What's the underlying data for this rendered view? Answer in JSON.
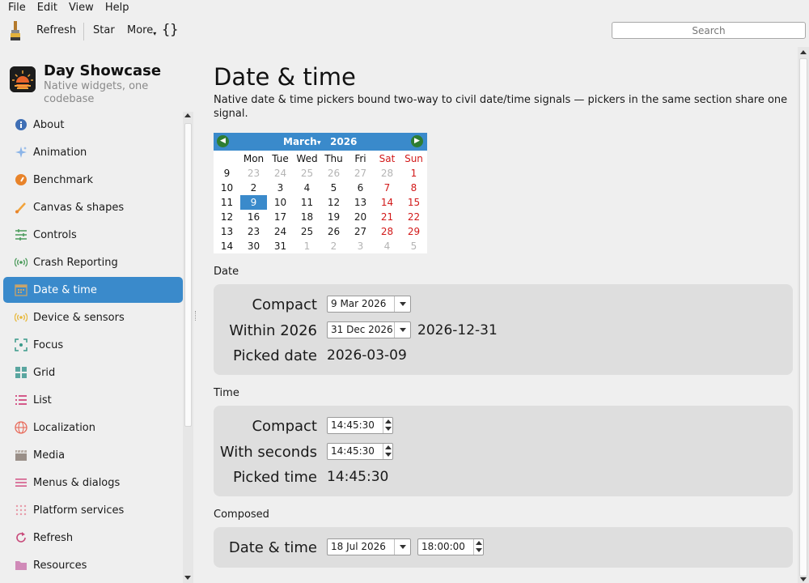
{
  "menu": [
    "File",
    "Edit",
    "View",
    "Help"
  ],
  "toolbar": {
    "refresh": "Refresh",
    "star": "Star",
    "more": "More",
    "braces": "{}",
    "search_placeholder": "Search"
  },
  "app": {
    "title": "Day Showcase",
    "subtitle": "Native widgets, one codebase"
  },
  "sidebar": {
    "items": [
      {
        "label": "About",
        "icon": "info-icon",
        "active": false
      },
      {
        "label": "Animation",
        "icon": "sparkle-icon",
        "active": false
      },
      {
        "label": "Benchmark",
        "icon": "gauge-icon",
        "active": false
      },
      {
        "label": "Canvas & shapes",
        "icon": "brush-icon",
        "active": false
      },
      {
        "label": "Controls",
        "icon": "sliders-icon",
        "active": false
      },
      {
        "label": "Crash Reporting",
        "icon": "broadcast-icon",
        "active": false
      },
      {
        "label": "Date & time",
        "icon": "calendar-icon",
        "active": true
      },
      {
        "label": "Device & sensors",
        "icon": "sensor-icon",
        "active": false
      },
      {
        "label": "Focus",
        "icon": "focus-icon",
        "active": false
      },
      {
        "label": "Grid",
        "icon": "grid-icon",
        "active": false
      },
      {
        "label": "List",
        "icon": "list-icon",
        "active": false
      },
      {
        "label": "Localization",
        "icon": "globe-icon",
        "active": false
      },
      {
        "label": "Media",
        "icon": "clapper-icon",
        "active": false
      },
      {
        "label": "Menus & dialogs",
        "icon": "menu-icon",
        "active": false
      },
      {
        "label": "Platform services",
        "icon": "dots-grid-icon",
        "active": false
      },
      {
        "label": "Refresh",
        "icon": "refresh-icon",
        "active": false
      },
      {
        "label": "Resources",
        "icon": "folder-icon",
        "active": false
      }
    ]
  },
  "page": {
    "title": "Date & time",
    "description": "Native date & time pickers bound two-way to civil date/time signals — pickers in the same section share one signal."
  },
  "calendar": {
    "month": "March",
    "year": "2026",
    "weekdays": [
      "Mon",
      "Tue",
      "Wed",
      "Thu",
      "Fri",
      "Sat",
      "Sun"
    ],
    "weeks": [
      {
        "wk": "9",
        "days": [
          "23",
          "24",
          "25",
          "26",
          "27",
          "28",
          "1"
        ]
      },
      {
        "wk": "10",
        "days": [
          "2",
          "3",
          "4",
          "5",
          "6",
          "7",
          "8"
        ]
      },
      {
        "wk": "11",
        "days": [
          "9",
          "10",
          "11",
          "12",
          "13",
          "14",
          "15"
        ]
      },
      {
        "wk": "12",
        "days": [
          "16",
          "17",
          "18",
          "19",
          "20",
          "21",
          "22"
        ]
      },
      {
        "wk": "13",
        "days": [
          "23",
          "24",
          "25",
          "26",
          "27",
          "28",
          "29"
        ]
      },
      {
        "wk": "14",
        "days": [
          "30",
          "31",
          "1",
          "2",
          "3",
          "4",
          "5"
        ]
      }
    ],
    "selected_day": "9"
  },
  "date_section": {
    "label": "Date",
    "compact_label": "Compact",
    "compact_value": "9 Mar 2026",
    "within_label": "Within 2026",
    "within_value": "31 Dec 2026",
    "within_readout": "2026-12-31",
    "picked_label": "Picked date",
    "picked_value": "2026-03-09"
  },
  "time_section": {
    "label": "Time",
    "compact_label": "Compact",
    "compact_value": "14:45:30",
    "seconds_label": "With seconds",
    "seconds_value": "14:45:30",
    "picked_label": "Picked time",
    "picked_value": "14:45:30"
  },
  "composed_section": {
    "label": "Composed",
    "row_label": "Date & time",
    "date_value": "18 Jul 2026",
    "time_value": "18:00:00"
  }
}
